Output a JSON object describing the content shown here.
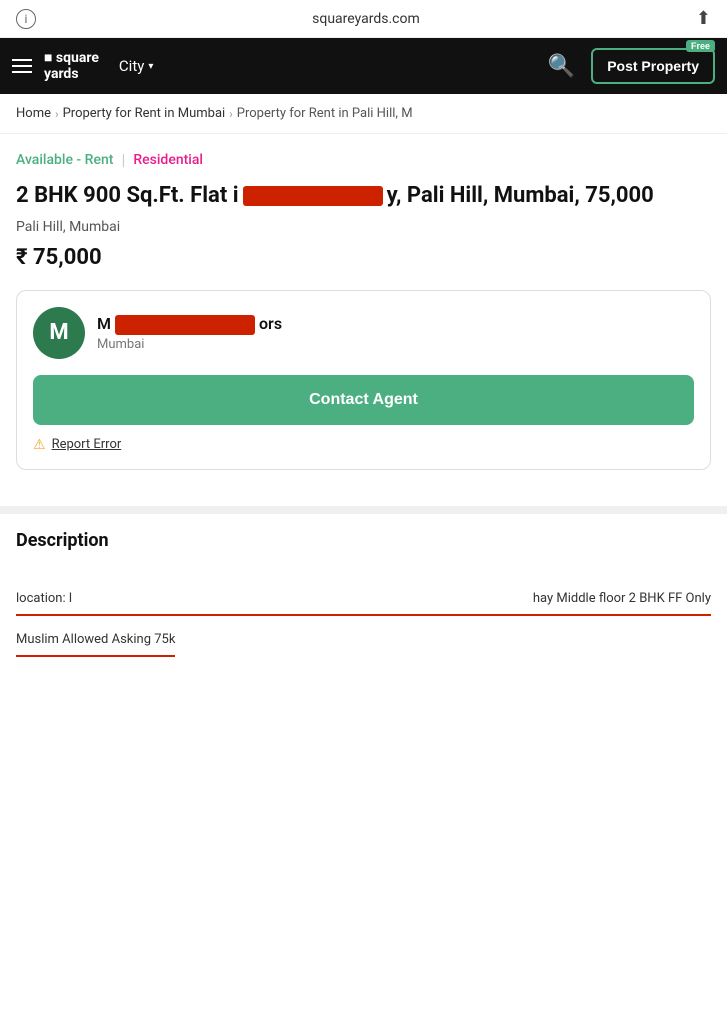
{
  "status_bar": {
    "url": "squareyards.com"
  },
  "navbar": {
    "logo_line1": "■ square",
    "logo_line2": "yards",
    "city_label": "City",
    "post_property_label": "Post Property",
    "free_badge": "Free"
  },
  "breadcrumb": {
    "home": "Home",
    "level1": "Property for Rent in Mumbai",
    "level2": "Property for Rent in Pali Hill, M"
  },
  "property": {
    "tag_available": "Available - Rent",
    "tag_divider": "|",
    "tag_type": "Residential",
    "title": "2 BHK 900 Sq.Ft. Flat i",
    "title_suffix": "y, Pali Hill, Mumbai, 75,000",
    "location": "Pali Hill, Mumbai",
    "price": "₹ 75,000"
  },
  "agent": {
    "avatar_letter": "M",
    "agent_name_prefix": "M",
    "agent_name_suffix": "ors",
    "agent_city": "Mumbai",
    "contact_label": "Contact Agent",
    "report_label": "Report Error"
  },
  "description": {
    "title": "Description",
    "line1_left": "location: l",
    "line1_right": "hay Middle floor 2 BHK FF Only",
    "line2": "Muslim Allowed Asking 75k"
  }
}
